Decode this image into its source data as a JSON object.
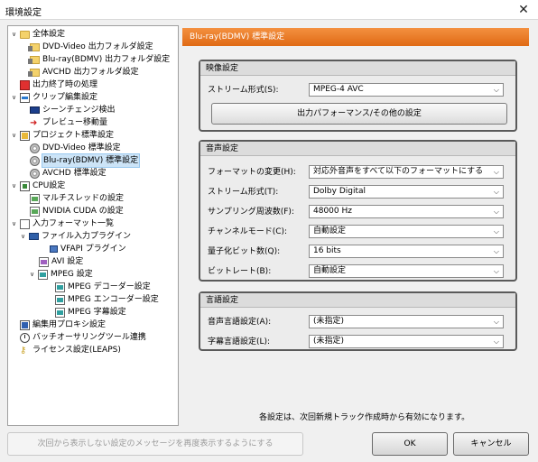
{
  "window": {
    "title": "環境設定",
    "close_glyph": "✕"
  },
  "tree": {
    "items": [
      {
        "label": "全体設定",
        "icon": "folder-icon",
        "chev": "∨"
      },
      {
        "label": "DVD-Video 出力フォルダ設定",
        "icon": "film-folder-icon"
      },
      {
        "label": "Blu-ray(BDMV) 出力フォルダ設定",
        "icon": "film-folder-icon"
      },
      {
        "label": "AVCHD 出力フォルダ設定",
        "icon": "film-folder-icon"
      },
      {
        "label": "出力終了時の処理",
        "icon": "stop-icon"
      },
      {
        "label": "クリップ編集設定",
        "icon": "clip-icon",
        "chev": "∨"
      },
      {
        "label": "シーンチェンジ検出",
        "icon": "scene-icon"
      },
      {
        "label": "プレビュー移動量",
        "icon": "arrow-icon"
      },
      {
        "label": "プロジェクト標準設定",
        "icon": "project-icon",
        "chev": "∨"
      },
      {
        "label": "DVD-Video 標準設定",
        "icon": "disc-icon"
      },
      {
        "label": "Blu-ray(BDMV) 標準設定",
        "icon": "disc-icon"
      },
      {
        "label": "AVCHD 標準設定",
        "icon": "disc-icon"
      },
      {
        "label": "CPU設定",
        "icon": "cpu-icon",
        "chev": "∨"
      },
      {
        "label": "マルチスレッドの設定",
        "icon": "page-icon"
      },
      {
        "label": "NVIDIA CUDA の設定",
        "icon": "page-icon"
      },
      {
        "label": "入力フォーマット一覧",
        "icon": "page-icon",
        "chev": "∨"
      },
      {
        "label": "ファイル入力プラグイン",
        "icon": "plugin-icon",
        "chev": "∨"
      },
      {
        "label": "VFAPI プラグイン",
        "icon": "plugin-icon"
      },
      {
        "label": "AVI 設定",
        "icon": "page-icon"
      },
      {
        "label": "MPEG 設定",
        "icon": "page-icon",
        "chev": "∨"
      },
      {
        "label": "MPEG デコーダー設定",
        "icon": "page-icon"
      },
      {
        "label": "MPEG エンコーダー設定",
        "icon": "page-icon"
      },
      {
        "label": "MPEG 字幕設定",
        "icon": "page-icon"
      },
      {
        "label": "編集用プロキシ設定",
        "icon": "proxy-icon"
      },
      {
        "label": "バッチオーサリングツール連携",
        "icon": "clock-icon"
      },
      {
        "label": "ライセンス設定(LEAPS)",
        "icon": "key-icon"
      }
    ],
    "selected_index": 10
  },
  "panel": {
    "header": "Blu-ray(BDMV) 標準設定",
    "video": {
      "title": "映像設定",
      "stream_label": "ストリーム形式(S):",
      "stream_value": "MPEG-4 AVC",
      "perf_button": "出力パフォーマンス/その他の設定"
    },
    "audio": {
      "title": "音声設定",
      "rows": [
        {
          "label": "フォーマットの変更(H):",
          "value": "対応外音声をすべて以下のフォーマットにする"
        },
        {
          "label": "ストリーム形式(T):",
          "value": "Dolby Digital"
        },
        {
          "label": "サンプリング周波数(F):",
          "value": "48000 Hz"
        },
        {
          "label": "チャンネルモード(C):",
          "value": "自動設定"
        },
        {
          "label": "量子化ビット数(Q):",
          "value": "16 bits"
        },
        {
          "label": "ビットレート(B):",
          "value": "自動設定"
        }
      ]
    },
    "language": {
      "title": "言語設定",
      "rows": [
        {
          "label": "音声言語設定(A):",
          "value": "(未指定)"
        },
        {
          "label": "字幕言語設定(L):",
          "value": "(未指定)"
        }
      ]
    },
    "note": "各設定は、次回新規トラック作成時から有効になります。"
  },
  "footer": {
    "restore_messages_button": "次回から表示しない設定のメッセージを再度表示するようにする",
    "ok_button": "OK",
    "cancel_button": "キャンセル"
  },
  "colors": {
    "header_orange": "#e8781e",
    "selection": "#cce4f7"
  }
}
